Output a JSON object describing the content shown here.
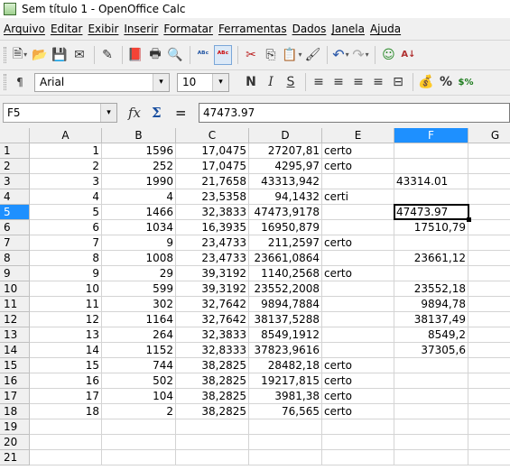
{
  "window": {
    "title": "Sem título 1 - OpenOffice Calc"
  },
  "menus": [
    "Arquivo",
    "Editar",
    "Exibir",
    "Inserir",
    "Formatar",
    "Ferramentas",
    "Dados",
    "Janela",
    "Ajuda"
  ],
  "toolbar_standard": [
    {
      "name": "new-document-icon",
      "glyph": "🗎"
    },
    {
      "name": "open-folder-icon",
      "glyph": "📂"
    },
    {
      "name": "save-icon",
      "glyph": "💾"
    },
    {
      "name": "email-icon",
      "glyph": "✉"
    },
    {
      "name": "edit-file-icon",
      "glyph": "✎"
    },
    {
      "name": "export-pdf-icon",
      "glyph": "📕"
    },
    {
      "name": "print-icon",
      "glyph": "🖶"
    },
    {
      "name": "page-preview-icon",
      "glyph": "🔍"
    },
    {
      "name": "spellcheck-icon",
      "glyph": "ᴬᴮᶜ"
    },
    {
      "name": "autospellcheck-icon",
      "glyph": "ᴬᴮᶜ"
    },
    {
      "name": "cut-icon",
      "glyph": "✂"
    },
    {
      "name": "copy-icon",
      "glyph": "⎘"
    },
    {
      "name": "paste-icon",
      "glyph": "📋"
    },
    {
      "name": "format-paintbrush-icon",
      "glyph": "🖌"
    },
    {
      "name": "undo-icon",
      "glyph": "↶"
    },
    {
      "name": "redo-icon",
      "glyph": "↷"
    },
    {
      "name": "navigator-icon",
      "glyph": "☺"
    },
    {
      "name": "sort-ascending-icon",
      "glyph": "A↓"
    }
  ],
  "formatting": {
    "font_name": "Arial",
    "font_size": "10",
    "bold": "N",
    "italic": "I",
    "underline": "S",
    "align_left_icon": "≡",
    "align_center_icon": "≡",
    "align_right_icon": "≡",
    "justify_icon": "≡",
    "merge_icon": "⊟",
    "currency_icon": "💰",
    "percent": "%",
    "number_format": "$%"
  },
  "formula_bar": {
    "cell_reference": "F5",
    "function_wizard": "𝑓x",
    "sum_symbol": "Σ",
    "equals_symbol": "=",
    "content": "47473.97"
  },
  "sheet": {
    "columns": [
      "A",
      "B",
      "C",
      "D",
      "E",
      "F",
      "G"
    ],
    "selected_column": "F",
    "selected_row": "5",
    "row_numbers": [
      "1",
      "2",
      "3",
      "4",
      "5",
      "6",
      "7",
      "8",
      "9",
      "10",
      "11",
      "12",
      "13",
      "14",
      "15",
      "16",
      "17",
      "18",
      "19",
      "20",
      "21"
    ],
    "rows": [
      [
        "1",
        "1596",
        "17,0475",
        "27207,81",
        "certo",
        ""
      ],
      [
        "2",
        "252",
        "17,0475",
        "4295,97",
        "certo",
        ""
      ],
      [
        "3",
        "1990",
        "21,7658",
        "43313,942",
        "",
        "43314.01"
      ],
      [
        "4",
        "4",
        "23,5358",
        "94,1432",
        "certi",
        ""
      ],
      [
        "5",
        "1466",
        "32,3833",
        "47473,9178",
        "",
        "47473.97"
      ],
      [
        "6",
        "1034",
        "16,3935",
        "16950,879",
        "",
        "17510,79"
      ],
      [
        "7",
        "9",
        "23,4733",
        "211,2597",
        "certo",
        ""
      ],
      [
        "8",
        "1008",
        "23,4733",
        "23661,0864",
        "",
        "23661,12"
      ],
      [
        "9",
        "29",
        "39,3192",
        "1140,2568",
        "certo",
        ""
      ],
      [
        "10",
        "599",
        "39,3192",
        "23552,2008",
        "",
        "23552,18"
      ],
      [
        "11",
        "302",
        "32,7642",
        "9894,7884",
        "",
        "9894,78"
      ],
      [
        "12",
        "1164",
        "32,7642",
        "38137,5288",
        "",
        "38137,49"
      ],
      [
        "13",
        "264",
        "32,3833",
        "8549,1912",
        "",
        "8549,2"
      ],
      [
        "14",
        "1152",
        "32,8333",
        "37823,9616",
        "",
        "37305,6"
      ],
      [
        "15",
        "744",
        "38,2825",
        "28482,18",
        "certo",
        ""
      ],
      [
        "16",
        "502",
        "38,2825",
        "19217,815",
        "certo",
        ""
      ],
      [
        "17",
        "104",
        "38,2825",
        "3981,38",
        "certo",
        ""
      ],
      [
        "18",
        "2",
        "38,2825",
        "76,565",
        "certo",
        ""
      ],
      [
        "",
        "",
        "",
        "",
        "",
        ""
      ],
      [
        "",
        "",
        "",
        "",
        "",
        ""
      ],
      [
        "",
        "",
        "",
        "",
        "",
        ""
      ]
    ],
    "f_left_aligned_rows": [
      3,
      5
    ]
  }
}
